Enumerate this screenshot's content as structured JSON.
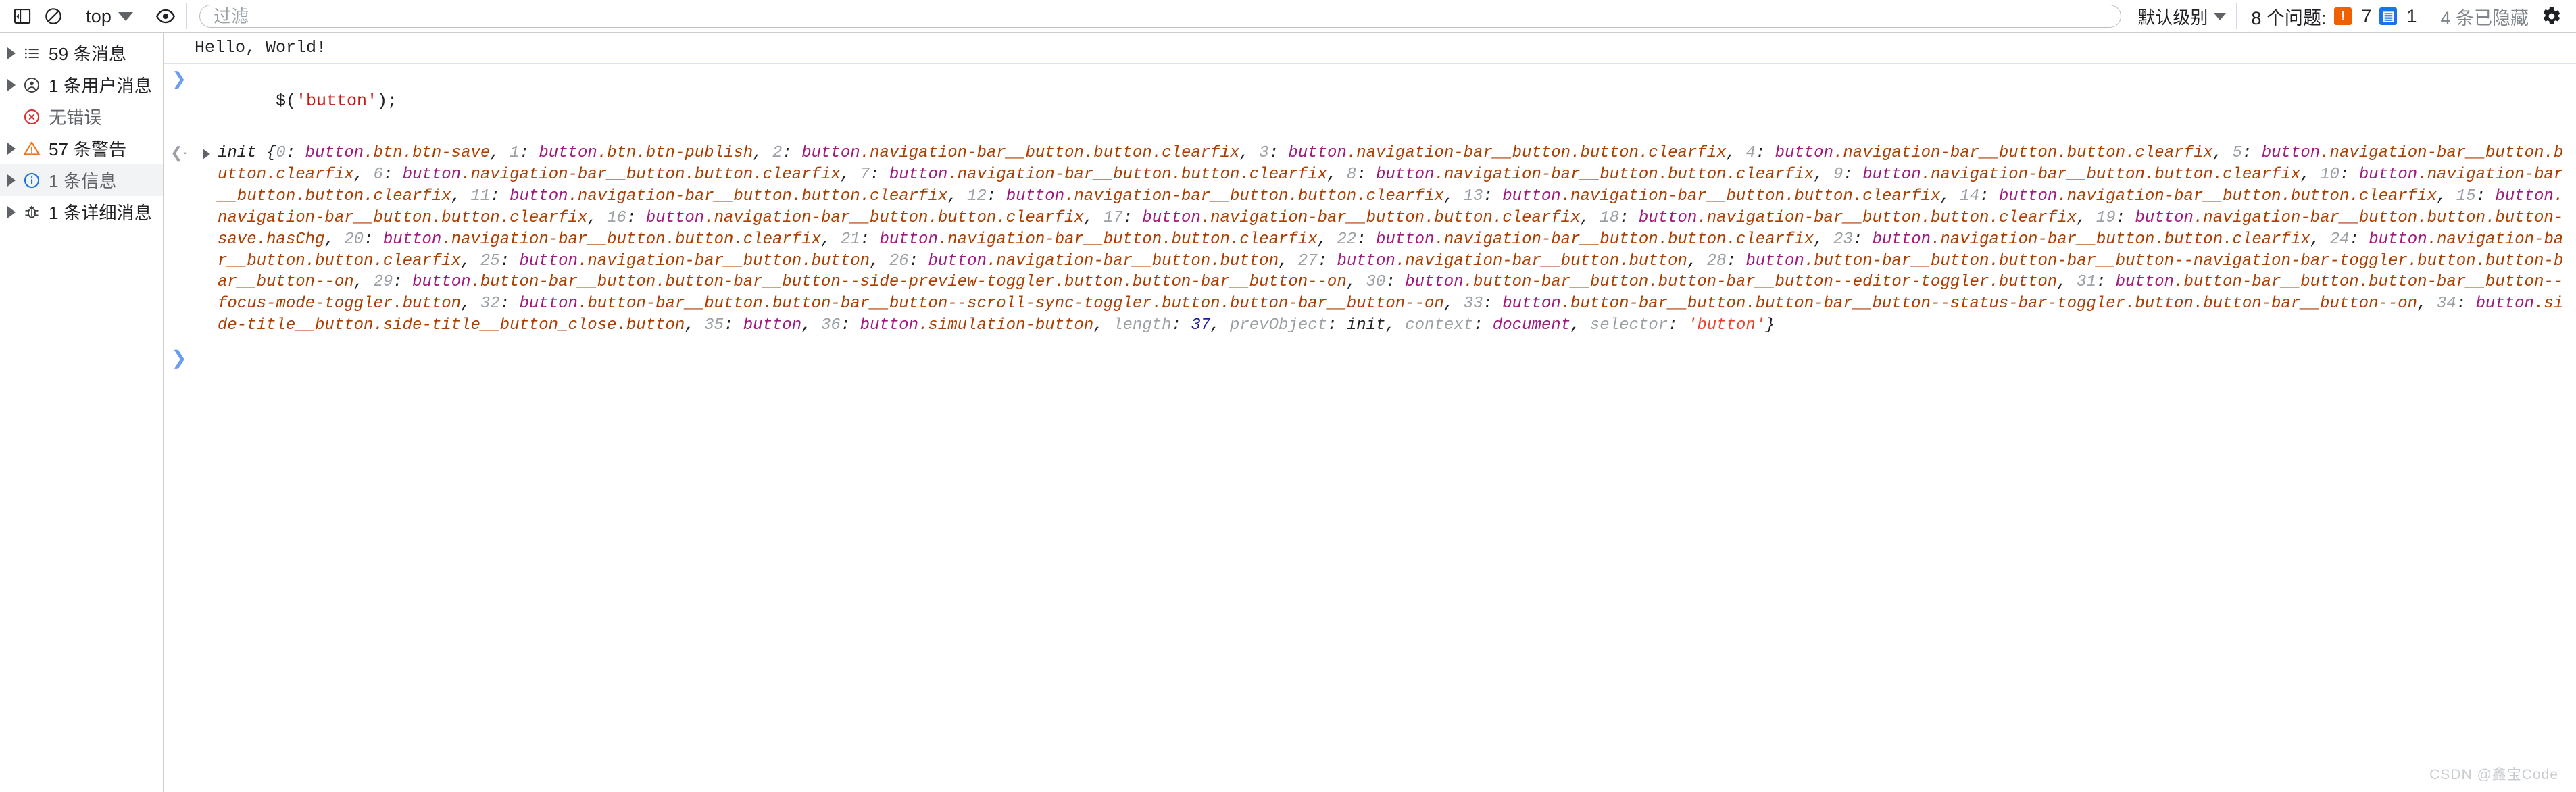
{
  "toolbar": {
    "sidebar_toggle_icon": "panel-toggle-icon",
    "clear_console_icon": "clear-console-icon",
    "context_label": "top",
    "eye_icon": "live-expression-eye-icon",
    "filter_placeholder": "过滤",
    "filter_value": "",
    "level_label": "默认级别",
    "issues_label": "8 个问题:",
    "error_badge_glyph": "!",
    "error_badge_count": "7",
    "error_badge_color": "#ee6002",
    "info_badge_glyph": "▤",
    "info_badge_count": "1",
    "info_badge_color": "#1a73e8",
    "hidden_label": "4 条已隐藏",
    "settings_icon": "gear-icon"
  },
  "sidebar": {
    "items": [
      {
        "label": "59 条消息",
        "icon": "list-icon",
        "expandable": true,
        "selected": false,
        "muted": false
      },
      {
        "label": "1 条用户消息",
        "icon": "user-icon",
        "expandable": true,
        "selected": false,
        "muted": false
      },
      {
        "label": "无错误",
        "icon": "error-icon",
        "expandable": false,
        "selected": false,
        "muted": true
      },
      {
        "label": "57 条警告",
        "icon": "warning-icon",
        "expandable": true,
        "selected": false,
        "muted": false
      },
      {
        "label": "1 条信息",
        "icon": "info-icon",
        "expandable": true,
        "selected": true,
        "muted": true
      },
      {
        "label": "1 条详细消息",
        "icon": "verbose-icon",
        "expandable": true,
        "selected": false,
        "muted": false
      }
    ]
  },
  "console": {
    "log_message": "Hello, World!",
    "command": "$('button');",
    "command_prefix": "$(",
    "command_string": "'button'",
    "command_suffix": ");",
    "result_prefix": "init {",
    "result_suffix": "}",
    "result_entries": [
      {
        "index": "0",
        "value": "button.btn.btn-save"
      },
      {
        "index": "1",
        "value": "button.btn.btn-publish"
      },
      {
        "index": "2",
        "value": "button.navigation-bar__button.button.clearfix"
      },
      {
        "index": "3",
        "value": "button.navigation-bar__button.button.clearfix"
      },
      {
        "index": "4",
        "value": "button.navigation-bar__button.button.clearfix"
      },
      {
        "index": "5",
        "value": "button.navigation-bar__button.button.clearfix"
      },
      {
        "index": "6",
        "value": "button.navigation-bar__button.button.clearfix"
      },
      {
        "index": "7",
        "value": "button.navigation-bar__button.button.clearfix"
      },
      {
        "index": "8",
        "value": "button.navigation-bar__button.button.clearfix"
      },
      {
        "index": "9",
        "value": "button.navigation-bar__button.button.clearfix"
      },
      {
        "index": "10",
        "value": "button.navigation-bar__button.button.clearfix"
      },
      {
        "index": "11",
        "value": "button.navigation-bar__button.button.clearfix"
      },
      {
        "index": "12",
        "value": "button.navigation-bar__button.button.clearfix"
      },
      {
        "index": "13",
        "value": "button.navigation-bar__button.button.clearfix"
      },
      {
        "index": "14",
        "value": "button.navigation-bar__button.button.clearfix"
      },
      {
        "index": "15",
        "value": "button.navigation-bar__button.button.clearfix"
      },
      {
        "index": "16",
        "value": "button.navigation-bar__button.button.clearfix"
      },
      {
        "index": "17",
        "value": "button.navigation-bar__button.button.clearfix"
      },
      {
        "index": "18",
        "value": "button.navigation-bar__button.button.clearfix"
      },
      {
        "index": "19",
        "value": "button.navigation-bar__button.button.button-save.hasChg"
      },
      {
        "index": "20",
        "value": "button.navigation-bar__button.button.clearfix"
      },
      {
        "index": "21",
        "value": "button.navigation-bar__button.button.clearfix"
      },
      {
        "index": "22",
        "value": "button.navigation-bar__button.button.clearfix"
      },
      {
        "index": "23",
        "value": "button.navigation-bar__button.button.clearfix"
      },
      {
        "index": "24",
        "value": "button.navigation-bar__button.button.clearfix"
      },
      {
        "index": "25",
        "value": "button.navigation-bar__button.button"
      },
      {
        "index": "26",
        "value": "button.navigation-bar__button.button"
      },
      {
        "index": "27",
        "value": "button.navigation-bar__button.button"
      },
      {
        "index": "28",
        "value": "button.button-bar__button.button-bar__button--navigation-bar-toggler.button.button-bar__button--on"
      },
      {
        "index": "29",
        "value": "button.button-bar__button.button-bar__button--side-preview-toggler.button.button-bar__button--on"
      },
      {
        "index": "30",
        "value": "button.button-bar__button.button-bar__button--editor-toggler.button"
      },
      {
        "index": "31",
        "value": "button.button-bar__button.button-bar__button--focus-mode-toggler.button"
      },
      {
        "index": "32",
        "value": "button.button-bar__button.button-bar__button--scroll-sync-toggler.button.button-bar__button--on"
      },
      {
        "index": "33",
        "value": "button.button-bar__button.button-bar__button--status-bar-toggler.button.button-bar__button--on"
      },
      {
        "index": "34",
        "value": "button.side-title__button.side-title__button_close.button"
      },
      {
        "index": "35",
        "value": "button"
      },
      {
        "index": "36",
        "value": "button.simulation-button"
      }
    ],
    "result_props": [
      {
        "key": "length",
        "value": "37",
        "kind": "number"
      },
      {
        "key": "prevObject",
        "value": "init",
        "kind": "init"
      },
      {
        "key": "context",
        "value": "document",
        "kind": "doc"
      },
      {
        "key": "selector",
        "value": "'button'",
        "kind": "string"
      }
    ],
    "prompt_symbol": "❯"
  },
  "watermark": "CSDN @鑫宝Code"
}
